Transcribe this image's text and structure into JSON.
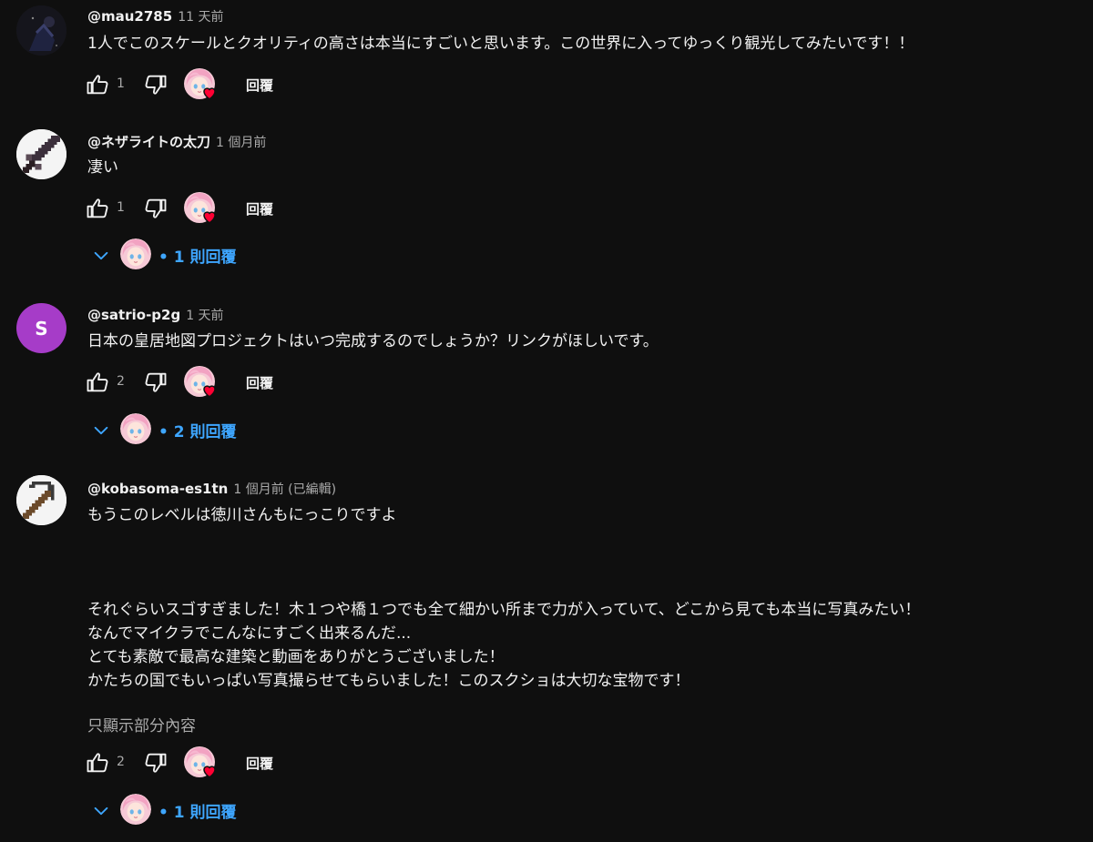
{
  "comments": [
    {
      "author": "@mau2785",
      "time": "11 天前",
      "text": "1人でこのスケールとクオリティの高さは本当にすごいと思います。この世界に入ってゆっくり観光してみたいです！！",
      "likes": "1",
      "reply_label": "回覆",
      "replies_label": null
    },
    {
      "author": "@ネザライトの太刀",
      "time": "1 個月前",
      "text": "凄い",
      "likes": "1",
      "reply_label": "回覆",
      "replies_label": "• 1 則回覆"
    },
    {
      "author": "@satrio-p2g",
      "time": "1 天前",
      "avatar_letter": "S",
      "text": "日本の皇居地図プロジェクトはいつ完成するのでしょうか？リンクがほしいです。",
      "likes": "2",
      "reply_label": "回覆",
      "replies_label": "• 2 則回覆"
    },
    {
      "author": "@kobasoma-es1tn",
      "time": "1 個月前 (已編輯)",
      "text": "もうこのレベルは徳川さんもにっこりですよ\n\n\n\nそれぐらいスゴすぎました！木１つや橋１つでも全て細かい所まで力が入っていて、どこから見ても本当に写真みたい！\nなんでマイクラでこんなにすごく出来るんだ...\nとても素敵で最高な建築と動画をありがとうございました！\nかたちの国でもいっぱい写真撮らせてもらいました！このスクショは大切な宝物です！",
      "read_more": "只顯示部分內容",
      "likes": "2",
      "reply_label": "回覆",
      "replies_label": "• 1 則回覆"
    }
  ],
  "colors": {
    "background": "#0f0f0f",
    "text": "#f1f1f1",
    "muted": "#aaaaaa",
    "link": "#3ea6ff",
    "heart": "#ff0033",
    "letter_avatar": "#a63cc8"
  }
}
